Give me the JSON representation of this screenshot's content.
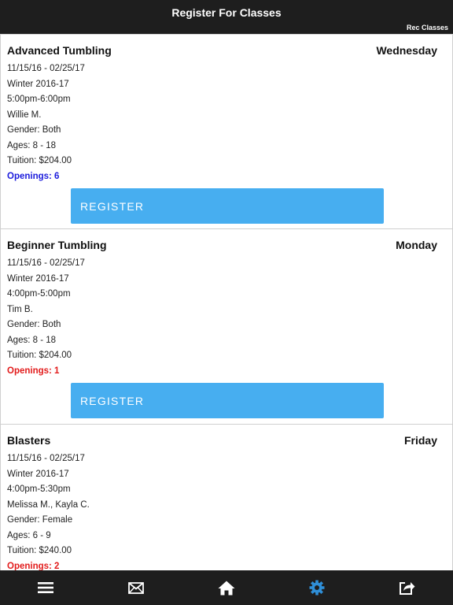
{
  "header": {
    "title": "Register For Classes",
    "subtitle": "Rec Classes"
  },
  "classes": [
    {
      "name": "Advanced Tumbling",
      "day": "Wednesday",
      "dates": "11/15/16 - 02/25/17",
      "session": "Winter 2016-17",
      "time": "5:00pm-6:00pm",
      "instructor": "Willie M.",
      "gender": "Gender: Both",
      "ages": "Ages: 8 - 18",
      "tuition": "Tuition: $204.00",
      "openings": "Openings: 6",
      "openings_color": "#1b1bdc",
      "button_label": "REGISTER"
    },
    {
      "name": "Beginner Tumbling",
      "day": "Monday",
      "dates": "11/15/16 - 02/25/17",
      "session": "Winter 2016-17",
      "time": "4:00pm-5:00pm",
      "instructor": "Tim B.",
      "gender": "Gender: Both",
      "ages": "Ages: 8 - 18",
      "tuition": "Tuition: $204.00",
      "openings": "Openings: 1",
      "openings_color": "#e21b1b",
      "button_label": "REGISTER"
    },
    {
      "name": "Blasters",
      "day": "Friday",
      "dates": "11/15/16 - 02/25/17",
      "session": "Winter 2016-17",
      "time": "4:00pm-5:30pm",
      "instructor": "Melissa M., Kayla C.",
      "gender": "Gender: Female",
      "ages": "Ages: 6 - 9",
      "tuition": "Tuition: $240.00",
      "openings": "Openings: 2",
      "openings_color": "#e21b1b"
    }
  ],
  "tabbar": {
    "items": [
      {
        "icon": "menu-icon",
        "active": false
      },
      {
        "icon": "mail-icon",
        "active": false
      },
      {
        "icon": "home-icon",
        "active": false
      },
      {
        "icon": "gear-icon",
        "active": true
      },
      {
        "icon": "share-icon",
        "active": false
      }
    ],
    "icon_color": "#ffffff",
    "active_color": "#2f8fd8"
  }
}
